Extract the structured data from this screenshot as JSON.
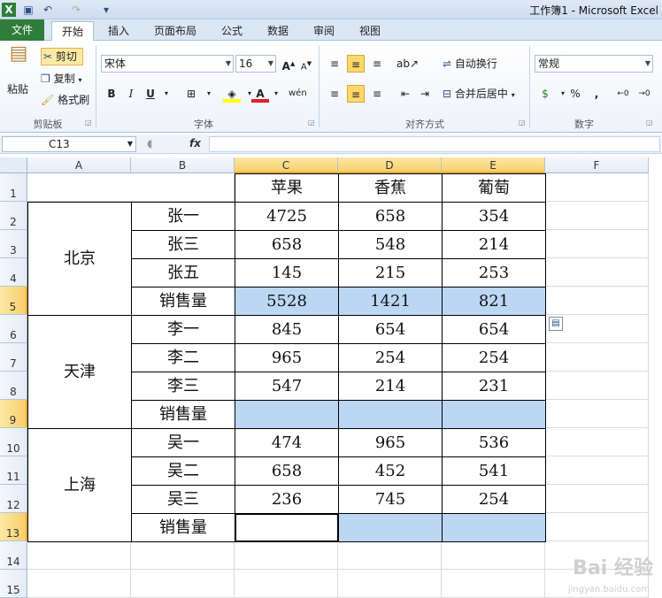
{
  "window": {
    "title": "工作簿1 - Microsoft Excel"
  },
  "tabs": [
    "文件",
    "开始",
    "插入",
    "页面布局",
    "公式",
    "数据",
    "审阅",
    "视图"
  ],
  "ribbon": {
    "clipboard": {
      "paste": "粘贴",
      "cut": "剪切",
      "copy": "复制",
      "format_painter": "格式刷",
      "label": "剪贴板"
    },
    "font": {
      "name": "宋体",
      "size": "16",
      "bold": "B",
      "italic": "I",
      "underline": "U",
      "label": "字体"
    },
    "alignment": {
      "wrap": "自动换行",
      "merge": "合并后居中",
      "label": "对齐方式"
    },
    "number": {
      "format": "常规",
      "percent": "%",
      "comma": ",",
      "label": "数字"
    }
  },
  "formula_bar": {
    "name_box": "C13",
    "fx": "fx",
    "value": ""
  },
  "columns": [
    "A",
    "B",
    "C",
    "D",
    "E",
    "F"
  ],
  "rows": [
    "1",
    "2",
    "3",
    "4",
    "5",
    "6",
    "7",
    "8",
    "9",
    "10",
    "11",
    "12",
    "13",
    "14",
    "15"
  ],
  "table": {
    "headers": [
      "苹果",
      "香蕉",
      "葡萄"
    ],
    "groups": [
      {
        "city": "北京",
        "rows": [
          {
            "name": "张一",
            "values": [
              "4725",
              "658",
              "354"
            ]
          },
          {
            "name": "张三",
            "values": [
              "658",
              "548",
              "214"
            ]
          },
          {
            "name": "张五",
            "values": [
              "145",
              "215",
              "253"
            ]
          },
          {
            "name": "销售量",
            "values": [
              "5528",
              "1421",
              "821"
            ]
          }
        ]
      },
      {
        "city": "天津",
        "rows": [
          {
            "name": "李一",
            "values": [
              "845",
              "654",
              "654"
            ]
          },
          {
            "name": "李二",
            "values": [
              "965",
              "254",
              "254"
            ]
          },
          {
            "name": "李三",
            "values": [
              "547",
              "214",
              "231"
            ]
          },
          {
            "name": "销售量",
            "values": [
              "",
              "",
              ""
            ]
          }
        ]
      },
      {
        "city": "上海",
        "rows": [
          {
            "name": "吴一",
            "values": [
              "474",
              "965",
              "536"
            ]
          },
          {
            "name": "吴二",
            "values": [
              "658",
              "452",
              "541"
            ]
          },
          {
            "name": "吴三",
            "values": [
              "236",
              "745",
              "254"
            ]
          },
          {
            "name": "销售量",
            "values": [
              "",
              "",
              ""
            ]
          }
        ]
      }
    ]
  },
  "watermark": {
    "brand": "Bai 经验",
    "url": "jingyan.baidu.com"
  },
  "colors": {
    "selection_fill": "#bcd7f4",
    "header_highlight": "#f7cf6a",
    "file_tab": "#2f7d3a"
  }
}
